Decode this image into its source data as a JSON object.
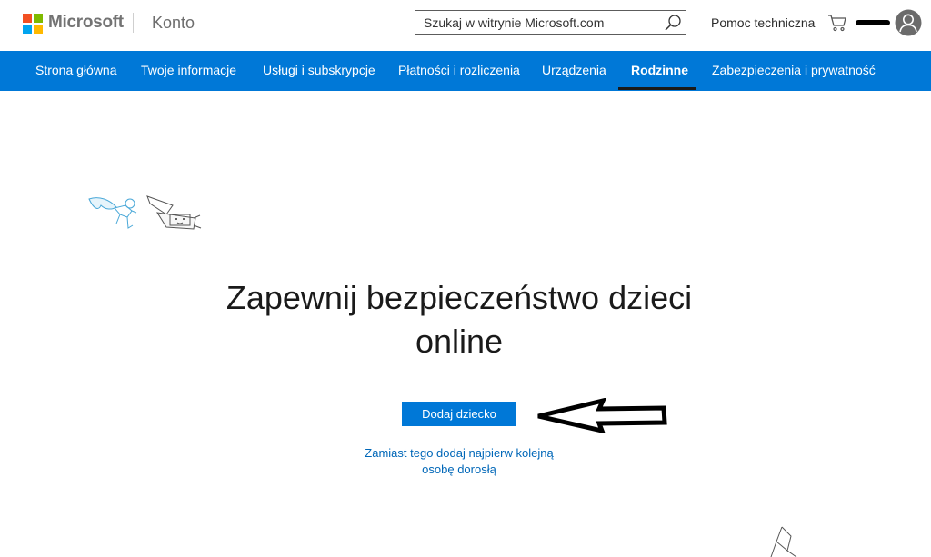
{
  "header": {
    "brand": "Microsoft",
    "section": "Konto",
    "search_placeholder": "Szukaj w witrynie Microsoft.com",
    "help_label": "Pomoc techniczna",
    "logo_colors": [
      "#f25022",
      "#7fba00",
      "#00a4ef",
      "#ffb900"
    ]
  },
  "nav": {
    "items": [
      {
        "label": "Strona główna"
      },
      {
        "label": "Twoje informacje"
      },
      {
        "label": "Usługi i subskrypcje"
      },
      {
        "label": "Płatności i rozliczenia"
      },
      {
        "label": "Urządzenia"
      },
      {
        "label": "Rodzinne",
        "active": true
      },
      {
        "label": "Zabezpieczenia i prywatność"
      }
    ]
  },
  "main": {
    "headline_line1": "Zapewnij bezpieczeństwo dzieci",
    "headline_line2": "online",
    "add_child_button": "Dodaj dziecko",
    "alt_link_line1": "Zamiast tego dodaj najpierw kolejną",
    "alt_link_line2": "osobę dorosłą"
  },
  "colors": {
    "accent": "#0078d7",
    "link": "#0067b8"
  }
}
